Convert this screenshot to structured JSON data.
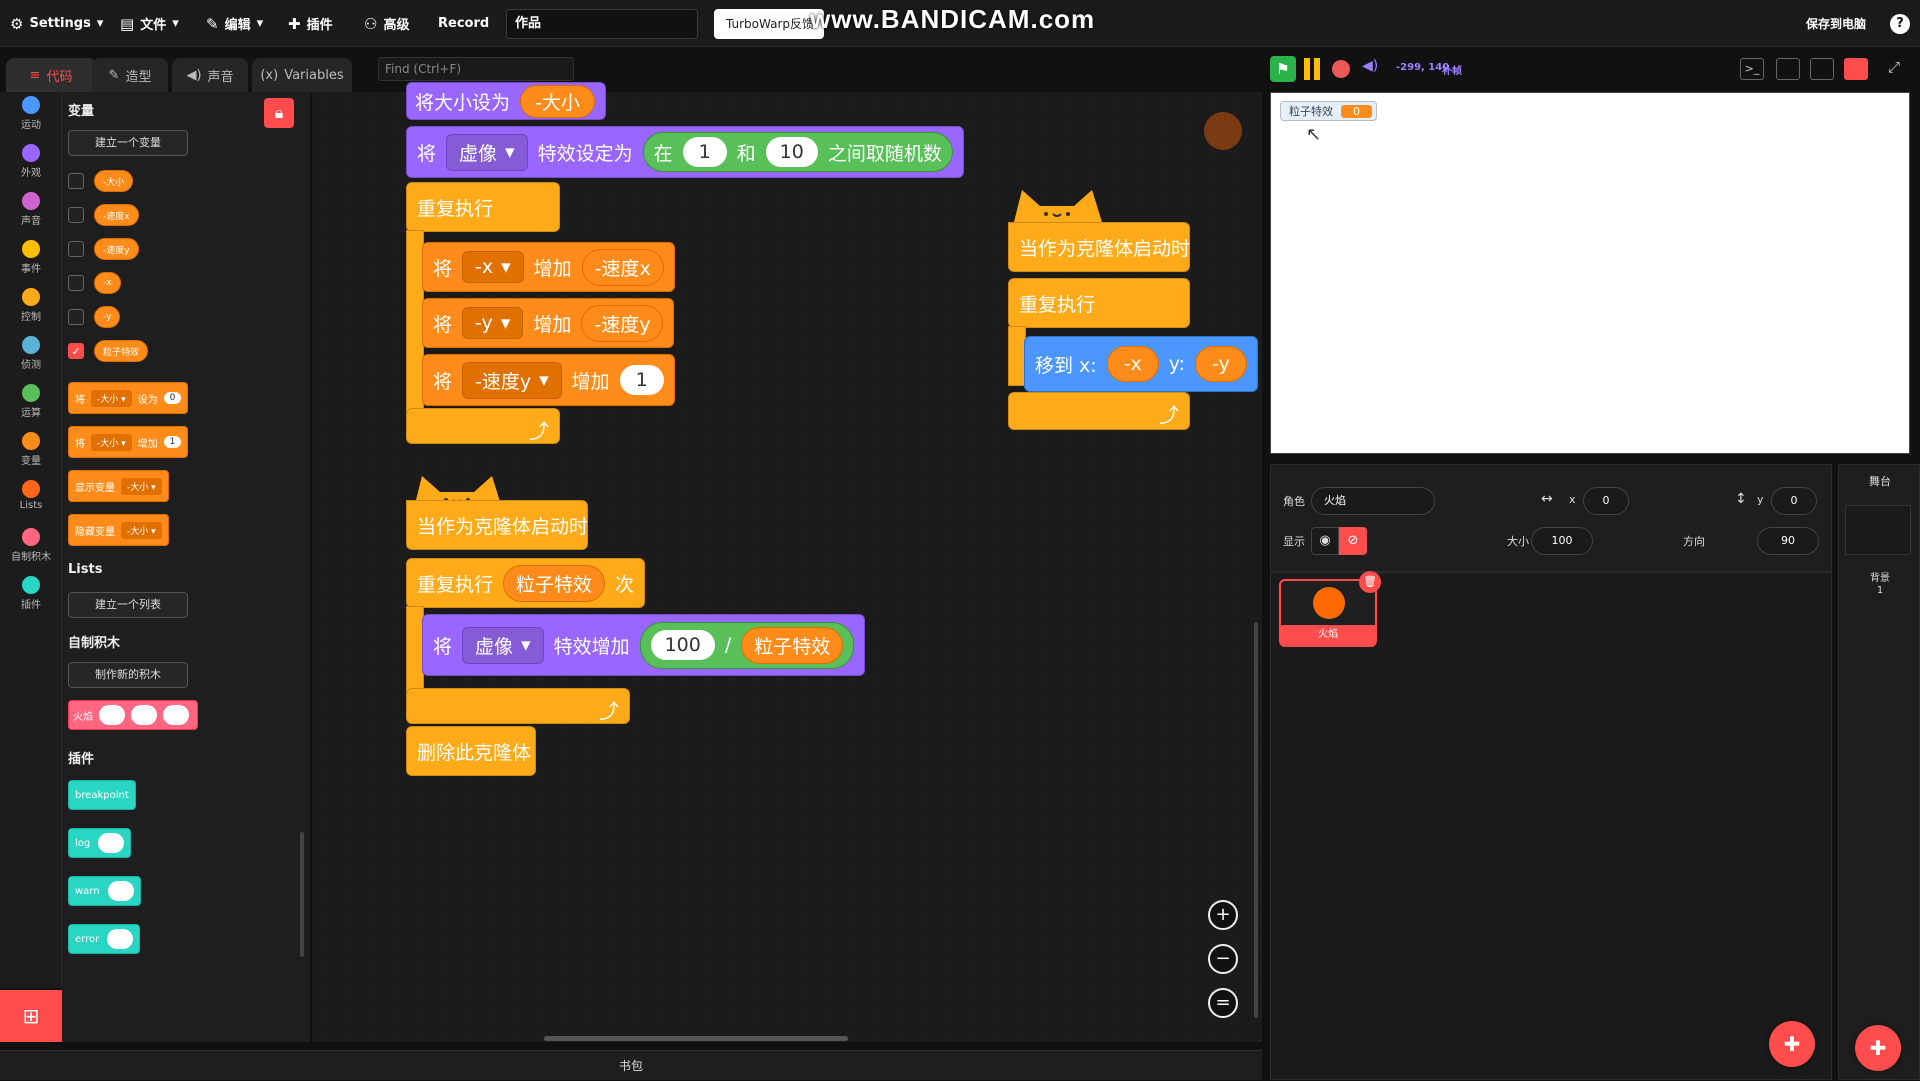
{
  "menubar": {
    "settings": "Settings",
    "file": "文件",
    "edit": "编辑",
    "addons": "插件",
    "advanced": "高级",
    "record": "Record",
    "project_title": "作品",
    "feedback": "TurboWarp反馈",
    "watermark": "www.BANDICAM.com",
    "save": "保存到电脑",
    "help": "?"
  },
  "tabs": {
    "code": "代码",
    "costumes": "造型",
    "sounds": "声音",
    "variables": "Variables"
  },
  "find": {
    "placeholder": "Find (Ctrl+F)"
  },
  "categories": [
    "运动",
    "外观",
    "声音",
    "事件",
    "控制",
    "侦测",
    "运算",
    "变量",
    "Lists",
    "自制积木",
    "插件"
  ],
  "category_colors": [
    "#4c97ff",
    "#9966ff",
    "#cf63cf",
    "#ffbf00",
    "#ffab19",
    "#5cb1d6",
    "#59c059",
    "#ff8c1a",
    "#ff661a",
    "#ff6680",
    "#29d6c3"
  ],
  "palette": {
    "variables_heading": "变量",
    "make_variable": "建立一个变量",
    "vars": [
      "-大小",
      "-速度x",
      "-速度y",
      "-x",
      "-y",
      "粒子特效"
    ],
    "set_block": {
      "verb": "将",
      "var": "-大小",
      "action": "设为",
      "value": "0"
    },
    "change_block": {
      "verb": "将",
      "var": "-大小",
      "action": "增加",
      "value": "1"
    },
    "show_block": {
      "action": "显示变量",
      "var": "-大小"
    },
    "hide_block": {
      "action": "隐藏变量",
      "var": "-大小"
    },
    "lists_heading": "Lists",
    "make_list": "建立一个列表",
    "custom_heading": "自制积木",
    "make_block": "制作新的积木",
    "custom_block": "火焰",
    "ext_heading": "插件",
    "ext_blocks": [
      "breakpoint",
      "log",
      "warn",
      "error"
    ]
  },
  "script1": {
    "set_size": "将大小设为",
    "size_var": "-大小",
    "effect_verb": "将",
    "effect_dd": "虚像",
    "effect_action": "特效设定为",
    "random_pre": "在",
    "random_from": "1",
    "random_and": "和",
    "random_to": "10",
    "random_post": "之间取随机数",
    "repeat": "重复执行",
    "row1": {
      "verb": "将",
      "var": "-x",
      "action": "增加",
      "value": "-速度x"
    },
    "row2": {
      "verb": "将",
      "var": "-y",
      "action": "增加",
      "value": "-速度y"
    },
    "row3": {
      "verb": "将",
      "var": "-速度y",
      "action": "增加",
      "value": "1"
    }
  },
  "script2": {
    "hat": "当作为克隆体启动时",
    "repeat": "重复执行",
    "var": "粒子特效",
    "times": "次",
    "verb": "将",
    "effect_dd": "虚像",
    "action": "特效增加",
    "num": "100",
    "op": "/",
    "denom": "粒子特效",
    "delete": "删除此克隆体"
  },
  "script3": {
    "hat": "当作为克隆体启动时",
    "repeat": "重复执行",
    "goto": "移到 x:",
    "x": "-x",
    "ylabel": "y:",
    "y": "-y"
  },
  "controls": {
    "coords": "-299, 140",
    "fill": "补帧"
  },
  "monitor": {
    "label": "粒子特效",
    "value": "0"
  },
  "sprite_info": {
    "sprite_label": "角色",
    "sprite_name": "火焰",
    "x_label": "x",
    "x": "0",
    "y_label": "y",
    "y": "0",
    "show_label": "显示",
    "size_label": "大小",
    "size": "100",
    "dir_label": "方向",
    "dir": "90"
  },
  "sprites": [
    {
      "name": "火焰"
    }
  ],
  "stage_pane": {
    "title": "舞台",
    "backdrops_label": "背景",
    "backdrops": "1"
  },
  "backpack": "书包"
}
